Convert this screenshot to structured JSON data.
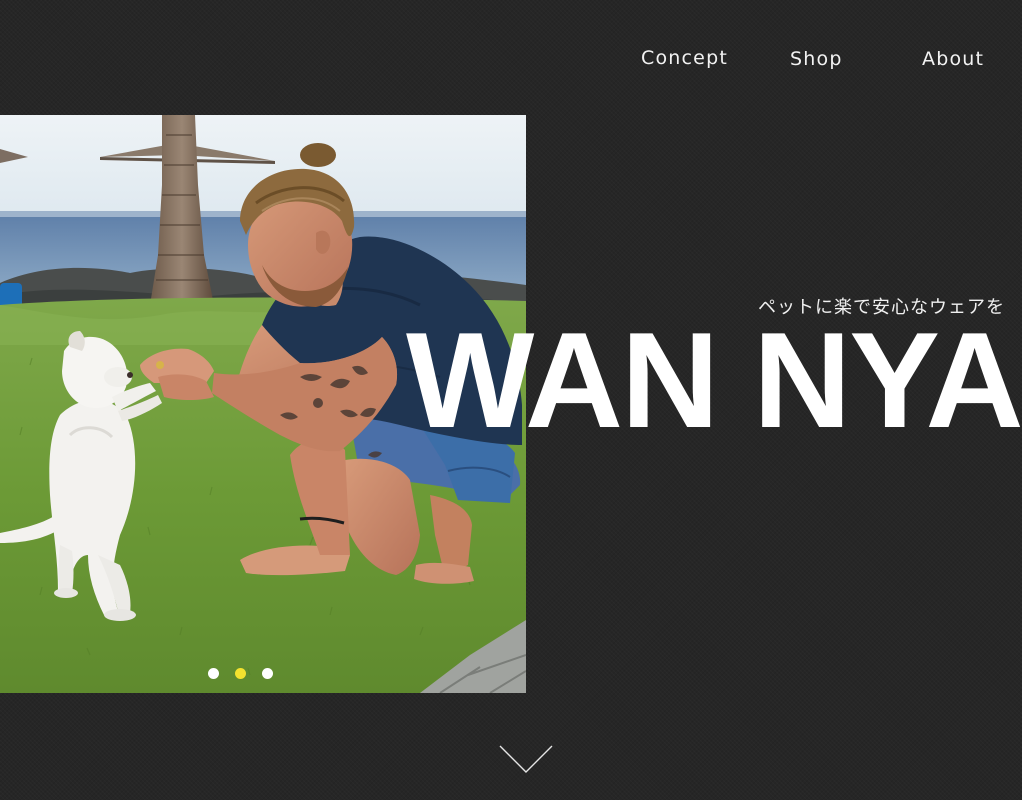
{
  "nav": {
    "items": [
      {
        "label": "Concept"
      },
      {
        "label": "Shop"
      },
      {
        "label": "About"
      }
    ]
  },
  "hero": {
    "tagline": "ペットに楽で安心なウェアを",
    "brand": "WAN NYA",
    "slider": {
      "count": 3,
      "active_index": 1
    }
  },
  "colors": {
    "background": "#262626",
    "text": "#ffffff",
    "active_dot": "#f4e22f",
    "inactive_dot": "#ffffff"
  },
  "icons": {
    "scroll": "chevron-down-icon"
  }
}
